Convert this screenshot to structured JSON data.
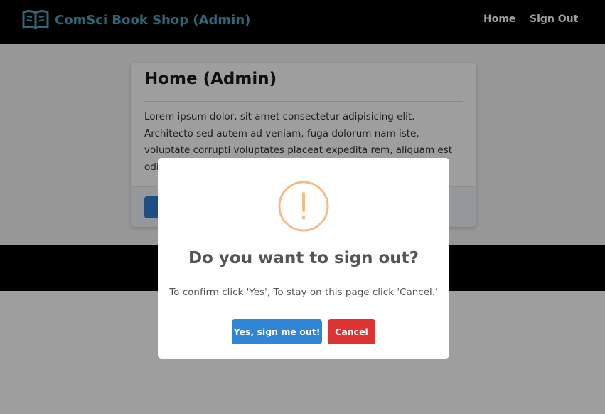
{
  "navbar": {
    "brand_icon": "open-book-icon",
    "brand_text": "ComSci Book Shop (Admin)",
    "links": [
      {
        "label": "Home"
      },
      {
        "label": "Sign Out"
      }
    ]
  },
  "card": {
    "title": "Home (Admin)",
    "body": "Lorem ipsum dolor, sit amet consectetur adipisicing elit. Architecto sed autem ad veniam, fuga dolorum nam iste, voluptate corrupti voluptates placeat expedita rem, aliquam est odit nulla aliquid nec"
  },
  "modal": {
    "icon": "warning-icon",
    "title": "Do you want to sign out?",
    "text": "To confirm click 'Yes', To stay on this page click 'Cancel.'",
    "confirm_label": "Yes, sign me out!",
    "cancel_label": "Cancel"
  },
  "colors": {
    "navbar_bg": "#000000",
    "brand": "#4aa6c2",
    "primary": "#3085d6",
    "danger": "#dd3333",
    "warning": "#f8bb86"
  }
}
